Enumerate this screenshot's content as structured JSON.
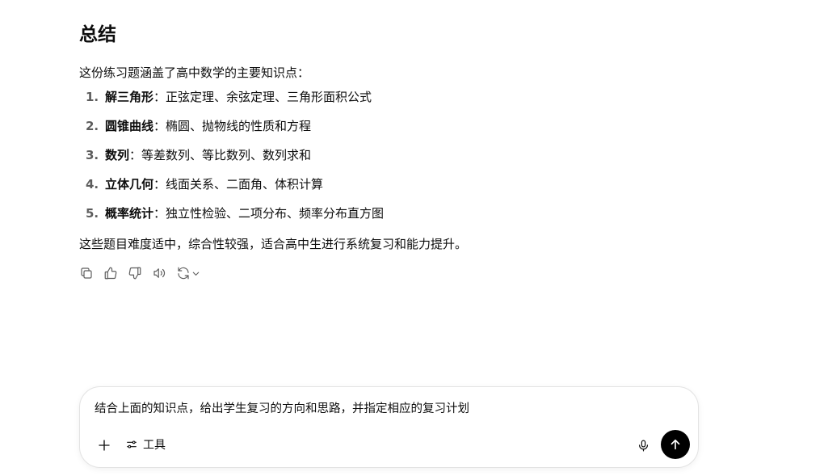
{
  "message": {
    "title": "总结",
    "intro": "这份练习题涵盖了高中数学的主要知识点：",
    "topics": [
      {
        "num": "1.",
        "term": "解三角形",
        "detail": "：正弦定理、余弦定理、三角形面积公式"
      },
      {
        "num": "2.",
        "term": "圆锥曲线",
        "detail": "：椭圆、抛物线的性质和方程"
      },
      {
        "num": "3.",
        "term": "数列",
        "detail": "：等差数列、等比数列、数列求和"
      },
      {
        "num": "4.",
        "term": "立体几何",
        "detail": "：线面关系、二面角、体积计算"
      },
      {
        "num": "5.",
        "term": "概率统计",
        "detail": "：独立性检验、二项分布、频率分布直方图"
      }
    ],
    "closing": "这些题目难度适中，综合性较强，适合高中生进行系统复习和能力提升。"
  },
  "actions": {
    "icons": [
      "copy-icon",
      "thumbs-up-icon",
      "thumbs-down-icon",
      "read-aloud-icon",
      "regenerate-icon",
      "chevron-down-icon"
    ]
  },
  "composer": {
    "prompt_text": "结合上面的知识点，给出学生复习的方向和思路，并指定相应的复习计划",
    "tools_label": "工具",
    "send_color": "#000000"
  }
}
